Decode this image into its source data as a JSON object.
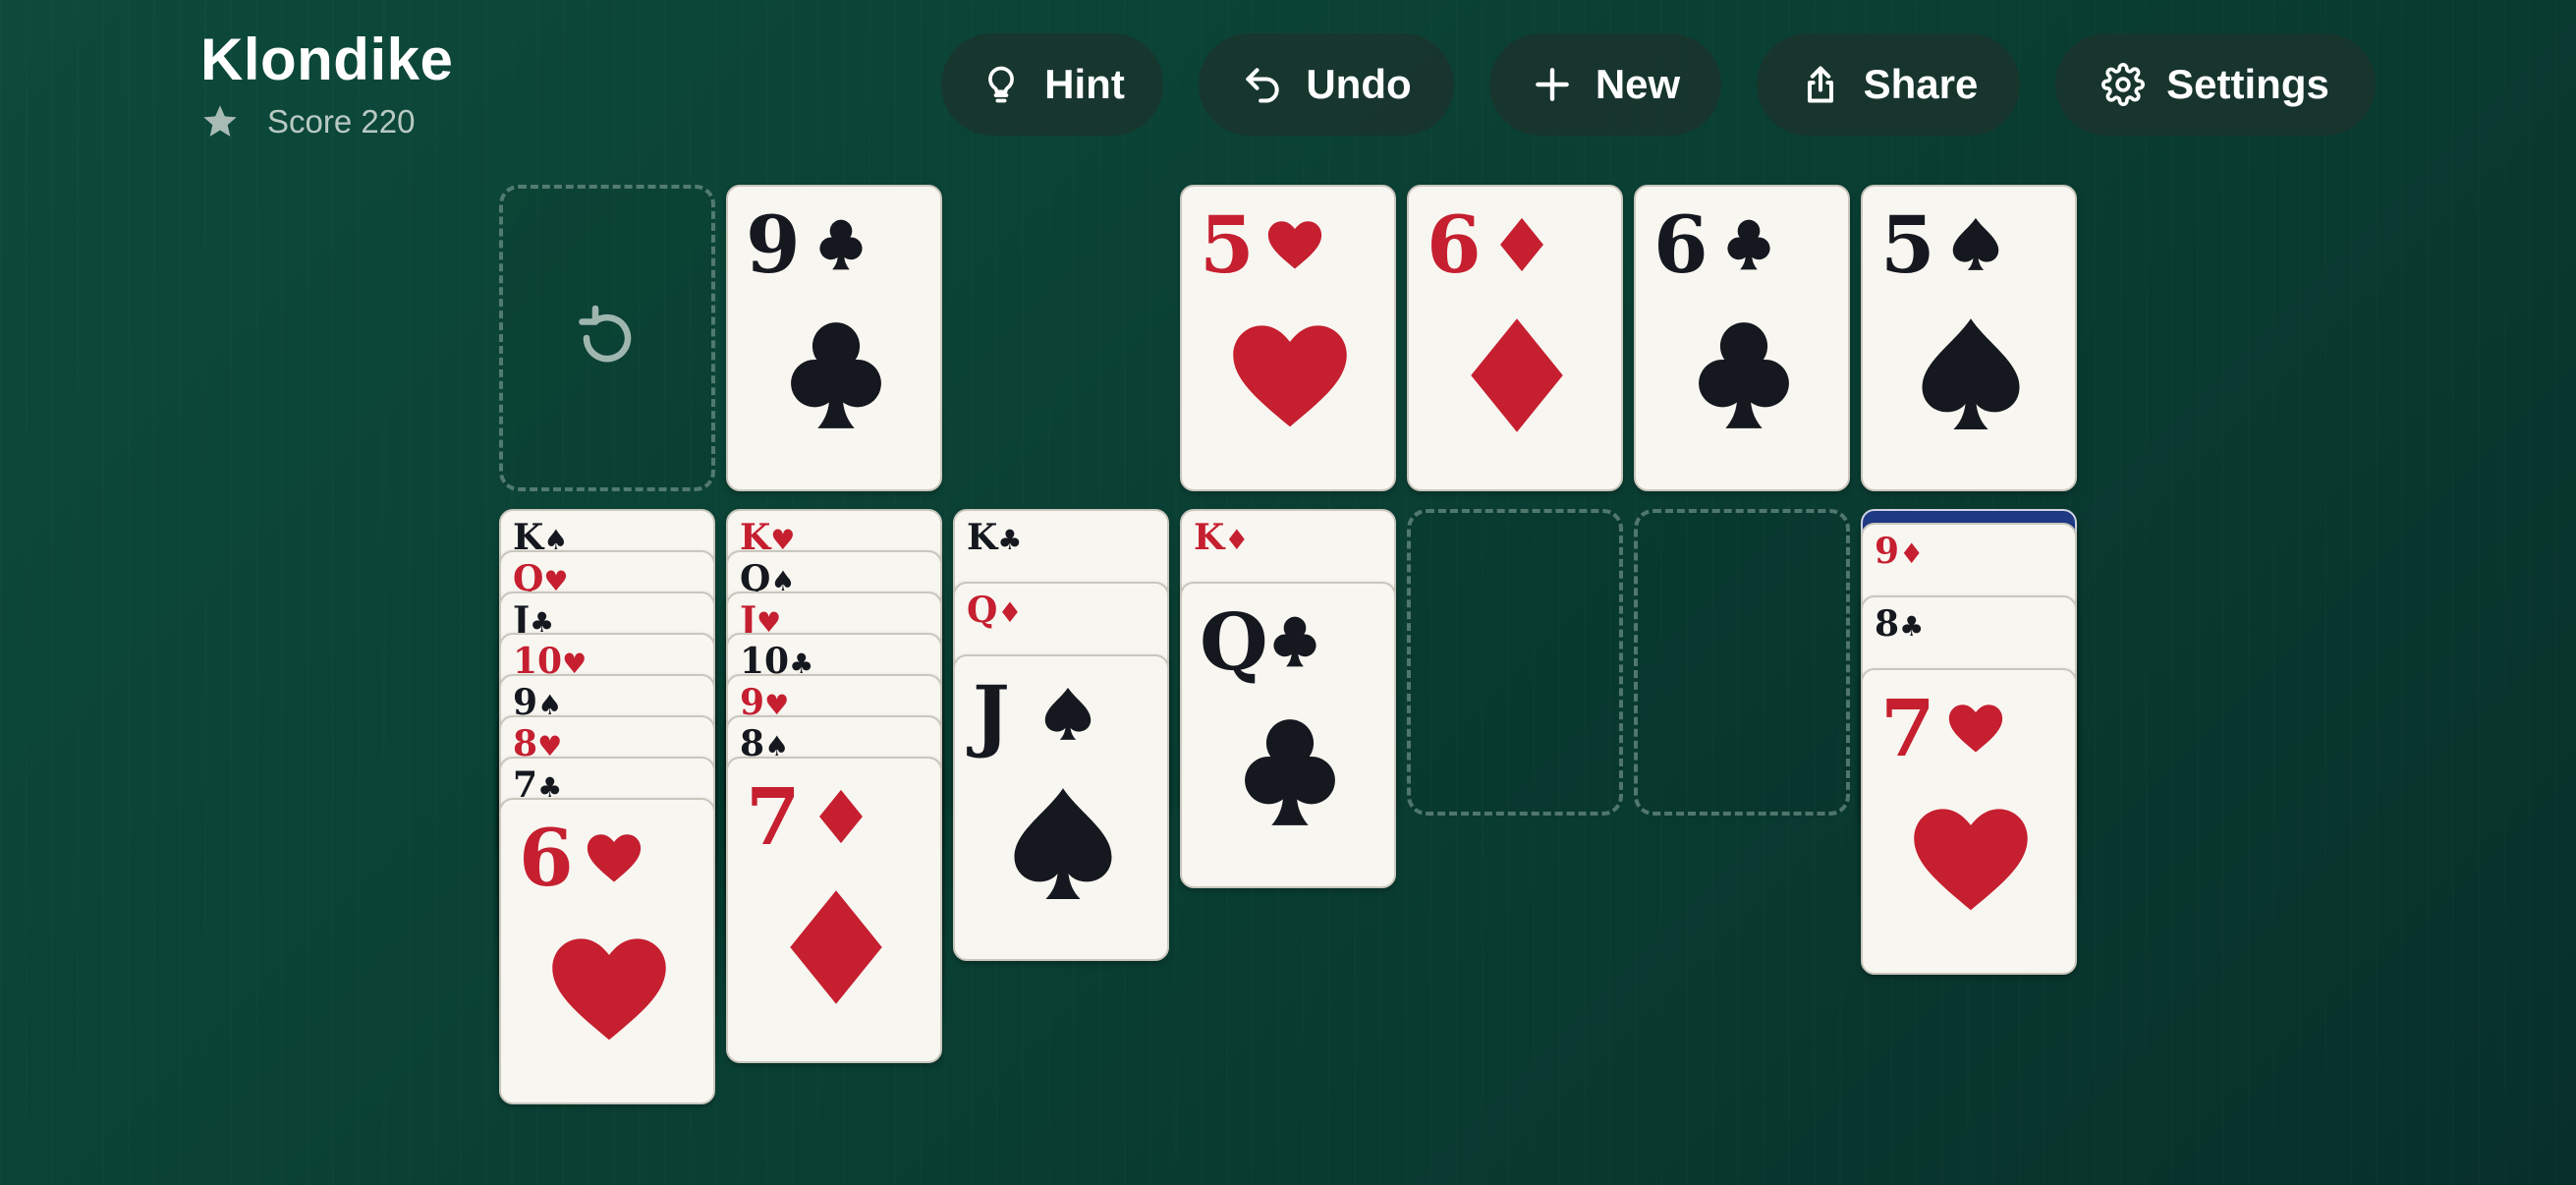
{
  "header": {
    "title": "Klondike",
    "score_label": "Score 220"
  },
  "toolbar": {
    "hint_label": "Hint",
    "undo_label": "Undo",
    "new_label": "New",
    "share_label": "Share",
    "settings_label": "Settings"
  },
  "stock": {
    "icon": "recycle-icon",
    "empty": true
  },
  "waste": {
    "top_card": {
      "rank": "9",
      "suit": "clubs",
      "glyph": "♣"
    }
  },
  "foundations": [
    {
      "rank": "5",
      "suit": "hearts",
      "glyph": "♥"
    },
    {
      "rank": "6",
      "suit": "diamonds",
      "glyph": "♦"
    },
    {
      "rank": "6",
      "suit": "clubs",
      "glyph": "♣"
    },
    {
      "rank": "5",
      "suit": "spades",
      "glyph": "♠"
    }
  ],
  "tableau": [
    {
      "cards": [
        {
          "rank": "K",
          "glyph": "♠",
          "color": "black"
        },
        {
          "rank": "Q",
          "glyph": "♥",
          "color": "red"
        },
        {
          "rank": "J",
          "glyph": "♣",
          "color": "black"
        },
        {
          "rank": "10",
          "glyph": "♥",
          "color": "red"
        },
        {
          "rank": "9",
          "glyph": "♠",
          "color": "black"
        },
        {
          "rank": "8",
          "glyph": "♥",
          "color": "red"
        },
        {
          "rank": "7",
          "glyph": "♣",
          "color": "black"
        },
        {
          "rank": "6",
          "glyph": "♥",
          "color": "red"
        }
      ]
    },
    {
      "cards": [
        {
          "rank": "K",
          "glyph": "♥",
          "color": "red"
        },
        {
          "rank": "Q",
          "glyph": "♠",
          "color": "black"
        },
        {
          "rank": "J",
          "glyph": "♥",
          "color": "red"
        },
        {
          "rank": "10",
          "glyph": "♣",
          "color": "black"
        },
        {
          "rank": "9",
          "glyph": "♥",
          "color": "red"
        },
        {
          "rank": "8",
          "glyph": "♠",
          "color": "black"
        },
        {
          "rank": "7",
          "glyph": "♦",
          "color": "red"
        }
      ]
    },
    {
      "cards": [
        {
          "rank": "K",
          "glyph": "♣",
          "color": "black"
        },
        {
          "rank": "Q",
          "glyph": "♦",
          "color": "red"
        },
        {
          "rank": "J",
          "glyph": "♠",
          "color": "black"
        }
      ]
    },
    {
      "cards": [
        {
          "rank": "K",
          "glyph": "♦",
          "color": "red"
        },
        {
          "rank": "Q",
          "glyph": "♣",
          "color": "black"
        }
      ]
    },
    {
      "cards": []
    },
    {
      "cards": []
    },
    {
      "face_down": 1,
      "cards": [
        {
          "rank": "9",
          "glyph": "♦",
          "color": "red"
        },
        {
          "rank": "8",
          "glyph": "♣",
          "color": "black"
        },
        {
          "rank": "7",
          "glyph": "♥",
          "color": "red"
        }
      ]
    }
  ],
  "colors": {
    "felt": "#0a3f33",
    "red_suit": "#c51f30",
    "black_suit": "#15181f",
    "card_face": "#f8f6f0",
    "card_back": "#1f3a85"
  }
}
